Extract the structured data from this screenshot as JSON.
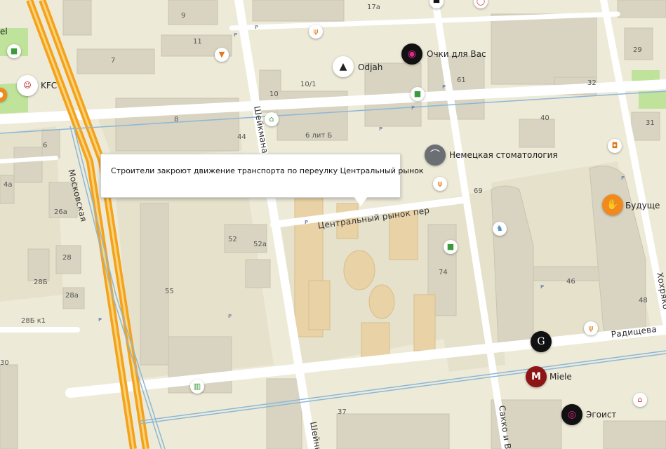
{
  "callout": {
    "text": "Строители закроют движение транспорта по переулку Центральный рынок"
  },
  "streets": {
    "moskovskaya": "Московская",
    "sheinkmana": "Шейкмана",
    "sheinkmana_bottom": "Шейнк",
    "tsentralny": "Центральный рынок пер",
    "radishcheva": "Радищева",
    "sakko": "Сакко и Ва",
    "khokhryakova": "Хохряко"
  },
  "pois": {
    "kfc": "KFC",
    "odjah": "Odjah",
    "ochki": "Очки для Вас",
    "dental": "Немецкая стоматология",
    "budushche": "Будуще",
    "miele": "Miele",
    "egoist": "Эгоист",
    "el": "el"
  },
  "houses": {
    "h9": "9",
    "h11": "11",
    "h7": "7",
    "h17a": "17а",
    "h29": "29",
    "h10": "10",
    "h10_1": "10/1",
    "h61": "61",
    "h32": "32",
    "h31": "31",
    "h8": "8",
    "h6lit": "6 лит Б",
    "h44": "44",
    "h40": "40",
    "h6": "6",
    "h4a": "4а",
    "h26a": "26а",
    "h69": "69",
    "h52": "52",
    "h52a": "52а",
    "h28": "28",
    "h74": "74",
    "h55": "55",
    "h28b": "28Б",
    "h28a": "28а",
    "h46": "46",
    "h48": "48",
    "h28bk1": "28Б к1",
    "h30": "30",
    "h37": "37"
  },
  "icons": [
    "kfc-icon",
    "odjah-icon",
    "glasses-icon",
    "tooth-icon",
    "hand-icon",
    "miele-icon",
    "egoist-icon",
    "g-icon",
    "shop-icon",
    "fork-icon",
    "cocktail-icon",
    "coffee-icon",
    "metro-icon",
    "hanger-icon"
  ],
  "colors": {
    "ground": "#eeead8",
    "block": "#e3dfc9",
    "building": "#d6d2c0",
    "road": "#ffffff",
    "highway": "#f6a623",
    "park": "#b6e08a",
    "newbuild": "#e8d2a8",
    "tram": "#86b3d6"
  }
}
